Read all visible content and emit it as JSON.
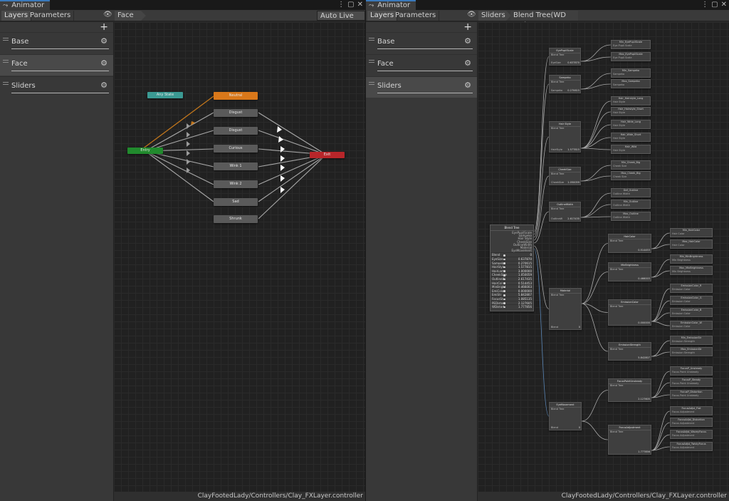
{
  "left_window": {
    "tab_title": "Animator",
    "tabs": [
      "Layers",
      "Parameters"
    ],
    "breadcrumb": [
      "Face"
    ],
    "auto_live_link": "Auto Live Link",
    "layers": [
      {
        "name": "Base",
        "selected": false
      },
      {
        "name": "Face",
        "selected": true
      },
      {
        "name": "Sliders",
        "selected": false
      }
    ],
    "states": {
      "any_state": "Any State",
      "default": "Neutral",
      "entry": "Entry",
      "exit": "Exit",
      "list": [
        "Disgust",
        "Disgust",
        "Curious",
        "Wink 1",
        "Wink 2",
        "Sad",
        "Shrunk"
      ]
    },
    "status_path": "ClayFootedLady/Controllers/Clay_FXLayer.controller"
  },
  "right_window": {
    "tab_title": "Animator",
    "tabs": [
      "Layers",
      "Parameters"
    ],
    "breadcrumb": [
      "Sliders",
      "Blend Tree(WD ON)"
    ],
    "layers": [
      {
        "name": "Base",
        "selected": false
      },
      {
        "name": "Face",
        "selected": false
      },
      {
        "name": "Sliders",
        "selected": true
      }
    ],
    "root_node": {
      "title": "Blend Tree",
      "outputs": [
        "EyePupilScale",
        "Sampeko",
        "Hair Style",
        "CheekSize",
        "OutlineWidth",
        "Material",
        "EyeMovement"
      ],
      "params": [
        {
          "name": "Blend",
          "value": "0"
        },
        {
          "name": "EyeSize",
          "value": "0.637870"
        },
        {
          "name": "Sampeko",
          "value": "0.270615"
        },
        {
          "name": "HairStyle",
          "value": "1.577815"
        },
        {
          "name": "HairLamp",
          "value": "3.000000"
        },
        {
          "name": "CheekSize",
          "value": "1.050059"
        },
        {
          "name": "OutlineW",
          "value": "2.617435"
        },
        {
          "name": "HairCol",
          "value": "0.514453"
        },
        {
          "name": "MinBright",
          "value": "0.466003"
        },
        {
          "name": "EmiColor",
          "value": "0.000000"
        },
        {
          "name": "EmiStr",
          "value": "5.842807"
        },
        {
          "name": "FocusSt",
          "value": "1.085135"
        },
        {
          "name": "PEDistort",
          "value": "2.127605"
        },
        {
          "name": "WDistort",
          "value": "1.777856"
        }
      ]
    },
    "mid_nodes": [
      {
        "title": "EyePupilScale",
        "sub": "Blend Tree",
        "param": "EyeSize",
        "value": "0.637870"
      },
      {
        "title": "Sampeko",
        "sub": "Blend Tree",
        "param": "Sampeko",
        "value": "0.270615"
      },
      {
        "title": "Hair Style",
        "sub": "Blend Tree",
        "param": "HairStyle",
        "value": "1.577815"
      },
      {
        "title": "CheekSize",
        "sub": "Blend Tree",
        "param": "CheekSize",
        "value": "1.050059"
      },
      {
        "title": "OutlineWidth",
        "sub": "Blend Tree",
        "param": "OutlineW",
        "value": "2.617435"
      },
      {
        "title": "Material",
        "sub": "Blend Tree",
        "param": "Blend",
        "value": "0"
      },
      {
        "title": "EyeMovement",
        "sub": "Blend Tree",
        "param": "Blend",
        "value": "0"
      }
    ],
    "sub_nodes": [
      {
        "title": "HairColor",
        "sub": "Blend Tree",
        "value": "0.514453"
      },
      {
        "title": "MinBrightness",
        "sub": "Blend Tree",
        "value": "0.466003"
      },
      {
        "title": "EmissionColor",
        "sub": "Blend Tree",
        "value": "0.000000"
      },
      {
        "title": "EmissionStrength",
        "sub": "Blend Tree",
        "value": "5.842807"
      },
      {
        "title": "FocusPointUnsteady",
        "sub": "Blend Tree",
        "value": "2.127605"
      },
      {
        "title": "FocusAdjustment",
        "sub": "Blend Tree",
        "value": "1.777856"
      }
    ],
    "clips": [
      {
        "title": "Min_EyePupilScale",
        "sub": "Eye Pupil Scale"
      },
      {
        "title": "Max_EyePupilScale",
        "sub": "Eye Pupil Scale"
      },
      {
        "title": "Min_Sampeko",
        "sub": "Sampeko"
      },
      {
        "title": "Max_Sampeko",
        "sub": "Sampeko"
      },
      {
        "title": "Hair_Hairstyle_Long",
        "sub": "Hair Style"
      },
      {
        "title": "Hair_Hairstyle_Short",
        "sub": "Hair Style"
      },
      {
        "title": "Hair_Wide_Long",
        "sub": "Hair Style"
      },
      {
        "title": "Hair_Wide_Short",
        "sub": "Hair Style"
      },
      {
        "title": "Hair_Wild",
        "sub": "Hair Style"
      },
      {
        "title": "Min_Cheek_Big",
        "sub": "Cheek Size"
      },
      {
        "title": "Max_Cheek_Big",
        "sub": "Cheek Size"
      },
      {
        "title": "Def_Outline",
        "sub": "Outline Width"
      },
      {
        "title": "Min_Outline",
        "sub": "Outline Width"
      },
      {
        "title": "Max_Outline",
        "sub": "Outline Width"
      },
      {
        "title": "Min_HairColor",
        "sub": "Hair Color"
      },
      {
        "title": "Max_HairColor",
        "sub": "Hair Color"
      },
      {
        "title": "Min_MinBrightness",
        "sub": "Min Brightness"
      },
      {
        "title": "Max_MinBrightness",
        "sub": "Min Brightness"
      },
      {
        "title": "EmissionColor_R",
        "sub": "Emission Color"
      },
      {
        "title": "EmissionColor_G",
        "sub": "Emission Color"
      },
      {
        "title": "EmissionColor_B",
        "sub": "Emission Color"
      },
      {
        "title": "EmissionColor_W",
        "sub": "Emission Color"
      },
      {
        "title": "Min_EmissionStr",
        "sub": "Emission Strength"
      },
      {
        "title": "Max_EmissionStr",
        "sub": "Emission Strength"
      },
      {
        "title": "FocusP_Unsteady",
        "sub": "Focus Point Unsteady"
      },
      {
        "title": "FocusP_Steady",
        "sub": "Focus Point Unsteady"
      },
      {
        "title": "FocusP_Distortion",
        "sub": "Focus Point Unsteady"
      },
      {
        "title": "FocusAdjst_Flat",
        "sub": "Focus Adjustment"
      },
      {
        "title": "FocusAdjst_Distortion",
        "sub": "Focus Adjustment"
      },
      {
        "title": "FocusAdjst_WaveyFocus",
        "sub": "Focus Adjustment"
      },
      {
        "title": "FocusAdjst_TwistyFocus",
        "sub": "Focus Adjustment"
      }
    ],
    "status_path": "ClayFootedLady/Controllers/Clay_FXLayer.controller"
  },
  "colors": {
    "accent": "#3a79bb",
    "any_state": "#3b9a93",
    "default_state": "#d9781a",
    "entry": "#218a2d",
    "exit": "#b8262a"
  },
  "icons": {
    "window": "animator-icon",
    "eye": "eye-icon",
    "plus": "plus-icon",
    "gear": "gear-icon",
    "menu": "kebab-menu-icon",
    "maximize": "maximize-icon",
    "close": "close-icon"
  }
}
